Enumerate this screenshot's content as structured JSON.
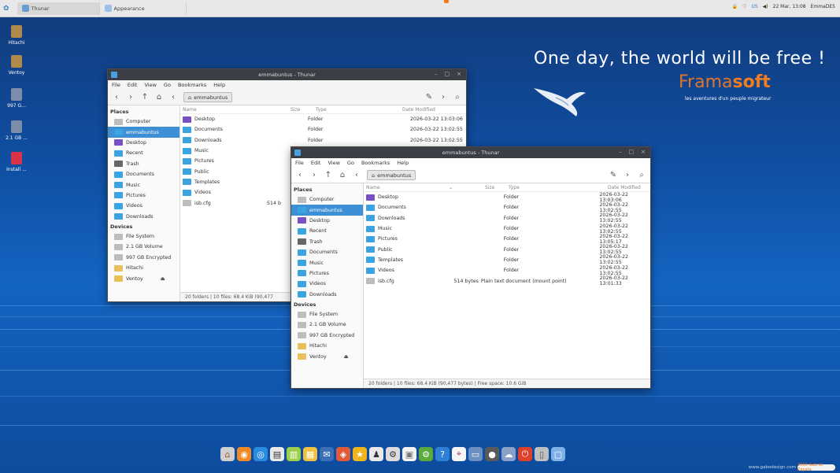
{
  "panel": {
    "tasks": [
      {
        "label": "Thunar",
        "active": true
      },
      {
        "label": "Appearance",
        "active": false
      }
    ],
    "tray": {
      "locale": "US",
      "clock": "22 Mar, 13:08",
      "user": "EmmaDE5"
    }
  },
  "desktop_icons": [
    "Hitachi",
    "Ventoy",
    "997 G...",
    "2.1 GB ...",
    "Install ..."
  ],
  "branding": {
    "slogan": "One day, the world will be free !",
    "brand_light": "Frama",
    "brand_bold": "soft",
    "tagline": "les aventures d'un peuple migrateur",
    "orange": "#f07d1f"
  },
  "back_window": {
    "title": "emmabuntus - Thunar",
    "menu": [
      "File",
      "Edit",
      "View",
      "Go",
      "Bookmarks",
      "Help"
    ],
    "path": "emmabuntus",
    "columns": {
      "name": "Name",
      "size": "Size",
      "type": "Type",
      "date": "Date Modified"
    },
    "places_header": "Places",
    "places": [
      "Computer",
      "emmabuntus",
      "Desktop",
      "Recent",
      "Trash",
      "Documents",
      "Music",
      "Pictures",
      "Videos",
      "Downloads"
    ],
    "devices_header": "Devices",
    "devices": [
      "File System",
      "2.1 GB Volume",
      "997 GB Encrypted",
      "Hitachi",
      "Ventoy"
    ],
    "rows": [
      {
        "name": "Desktop",
        "type": "Folder",
        "date": "2026-03-22 13:03:06"
      },
      {
        "name": "Documents",
        "type": "Folder",
        "date": "2026-03-22 13:02:55"
      },
      {
        "name": "Downloads",
        "type": "Folder",
        "date": "2026-03-22 13:02:55"
      },
      {
        "name": "Music",
        "type": "",
        "date": ""
      },
      {
        "name": "Pictures",
        "type": "",
        "date": ""
      },
      {
        "name": "Public",
        "type": "",
        "date": ""
      },
      {
        "name": "Templates",
        "type": "",
        "date": ""
      },
      {
        "name": "Videos",
        "type": "",
        "date": ""
      },
      {
        "name": "isb.cfg",
        "size": "514 b",
        "type": "",
        "date": ""
      }
    ],
    "status": "20 folders | 10 files: 68.4 KiB (90,477"
  },
  "front_window": {
    "title": "emmabuntus - Thunar",
    "menu": [
      "File",
      "Edit",
      "View",
      "Go",
      "Bookmarks",
      "Help"
    ],
    "path": "emmabuntus",
    "columns": {
      "name": "Name",
      "size": "Size",
      "type": "Type",
      "date": "Date Modified"
    },
    "places_header": "Places",
    "places": [
      "Computer",
      "emmabuntus",
      "Desktop",
      "Recent",
      "Trash",
      "Documents",
      "Music",
      "Pictures",
      "Videos",
      "Downloads"
    ],
    "devices_header": "Devices",
    "devices": [
      "File System",
      "2.1 GB Volume",
      "997 GB Encrypted",
      "Hitachi",
      "Ventoy"
    ],
    "rows": [
      {
        "name": "Desktop",
        "size": "",
        "type": "Folder",
        "date": "2026-03-22 13:03:06"
      },
      {
        "name": "Documents",
        "size": "",
        "type": "Folder",
        "date": "2026-03-22 13:02:55"
      },
      {
        "name": "Downloads",
        "size": "",
        "type": "Folder",
        "date": "2026-03-22 13:02:55"
      },
      {
        "name": "Music",
        "size": "",
        "type": "Folder",
        "date": "2026-03-22 13:02:55"
      },
      {
        "name": "Pictures",
        "size": "",
        "type": "Folder",
        "date": "2026-03-22 13:05:17"
      },
      {
        "name": "Public",
        "size": "",
        "type": "Folder",
        "date": "2026-03-22 13:02:55"
      },
      {
        "name": "Templates",
        "size": "",
        "type": "Folder",
        "date": "2026-03-22 13:02:55"
      },
      {
        "name": "Videos",
        "size": "",
        "type": "Folder",
        "date": "2026-03-22 13:02:55"
      },
      {
        "name": "isb.cfg",
        "size": "514 bytes",
        "type": "Plain text document (mount point)",
        "date": "2026-03-22 13:01:33"
      }
    ],
    "status": "20 folders | 10 files: 68.4 KiB (90,477 bytes) | Free space: 10.6 GiB"
  },
  "bottom": {
    "site": "www.gabodesign.com",
    "badge": "2026 Gabriel Zapata"
  }
}
